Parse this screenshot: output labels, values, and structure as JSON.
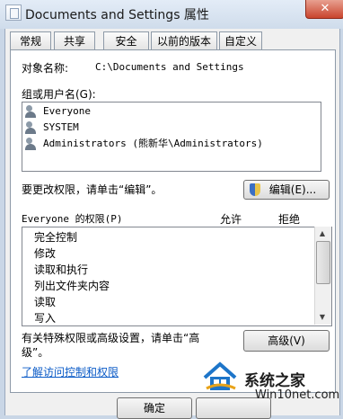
{
  "window": {
    "title": "Documents and Settings 属性",
    "close_label": "✕"
  },
  "tabs": [
    {
      "label": "常规"
    },
    {
      "label": "共享"
    },
    {
      "label": "安全",
      "active": true
    },
    {
      "label": "以前的版本"
    },
    {
      "label": "自定义"
    }
  ],
  "security": {
    "object_name_label": "对象名称:",
    "object_name_value": "C:\\Documents and Settings",
    "group_label": "组或用户名(G):",
    "users": [
      {
        "name": "Everyone",
        "icon": "users-group-icon"
      },
      {
        "name": "SYSTEM",
        "icon": "users-group-icon"
      },
      {
        "name": "Administrators (熊新华\\Administrators)",
        "icon": "users-group-icon"
      }
    ],
    "change_hint": "要更改权限，请单击“编辑”。",
    "edit_button": "编辑(E)...",
    "permissions_label": "Everyone 的权限(P)",
    "allow_header": "允许",
    "deny_header": "拒绝",
    "permissions": [
      "完全控制",
      "修改",
      "读取和执行",
      "列出文件夹内容",
      "读取",
      "写入"
    ],
    "advanced_hint_line1": "有关特殊权限或高级设置，请单击“高",
    "advanced_hint_line2": "级”。",
    "advanced_button": "高级(V)",
    "learn_link": "了解访问控制和权限"
  },
  "footer": {
    "ok_button": "确定"
  },
  "watermark": {
    "brand": "系统之家",
    "site": "Win10net.com"
  },
  "colors": {
    "accent": "#0b5bc7",
    "close": "#c9452e"
  }
}
